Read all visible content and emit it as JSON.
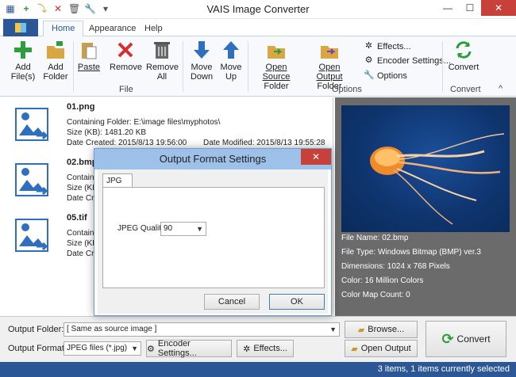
{
  "window": {
    "title": "VAIS Image Converter",
    "minimize": "—",
    "maximize": "☐",
    "close": "✕"
  },
  "qat": [
    "▦",
    "+",
    "⤵",
    "✕",
    "🗑",
    "🔧",
    "▾"
  ],
  "tabs": [
    "Home",
    "Appearance",
    "Help"
  ],
  "ribbon": {
    "add_files": [
      "Add",
      "File(s)"
    ],
    "add_folder": [
      "Add",
      "Folder"
    ],
    "paste": "Paste",
    "remove": "Remove",
    "remove_all": [
      "Remove",
      "All"
    ],
    "move_down": [
      "Move",
      "Down"
    ],
    "move_up": [
      "Move",
      "Up"
    ],
    "group_file": "File",
    "open_source": [
      "Open Source",
      "Folder"
    ],
    "open_output": [
      "Open Output",
      "Folder"
    ],
    "effects": "Effects...",
    "encoder_settings": "Encoder Settings...",
    "options": "Options",
    "group_options": "Options",
    "convert": "Convert",
    "group_convert": "Convert",
    "collapse": "^"
  },
  "files": [
    {
      "name": "01.png",
      "folder": "Containing Folder:   E:\\image files\\myphotos\\",
      "size": "Size (KB):   1481.20 KB",
      "created": "Date Created:   2015/8/13 19:56:00",
      "modified": "Date Modified:   2015/8/13 19:55:28"
    },
    {
      "name": "02.bmp",
      "folder": "Containi",
      "size": "Size (KB",
      "created": "Date Cre"
    },
    {
      "name": "05.tif",
      "folder": "Containi",
      "size": "Size (KB",
      "created": "Date Cre"
    }
  ],
  "preview": {
    "file_name": "File Name: 02.bmp",
    "file_type": "File Type: Windows Bitmap (BMP) ver.3",
    "dimensions": "Dimensions: 1024 x 768 Pixels",
    "color": "Color: 16 Million Colors",
    "color_map": "Color Map Count: 0"
  },
  "bottom": {
    "output_folder_label": "Output Folder:",
    "output_folder_value": "[ Same as source image ]",
    "browse": "Browse...",
    "output_format_label": "Output Format:",
    "output_format_value": "JPEG files (*.jpg)",
    "encoder_settings": "Encoder Settings...",
    "effects": "Effects...",
    "open_output": "Open Output",
    "convert": "Convert"
  },
  "status": "3 items, 1 items currently selected",
  "dialog": {
    "title": "Output Format Settings",
    "close": "✕",
    "tab": "JPG",
    "quality_label": "JPEG Quality:",
    "quality_value": "90",
    "cancel": "Cancel",
    "ok": "OK"
  }
}
